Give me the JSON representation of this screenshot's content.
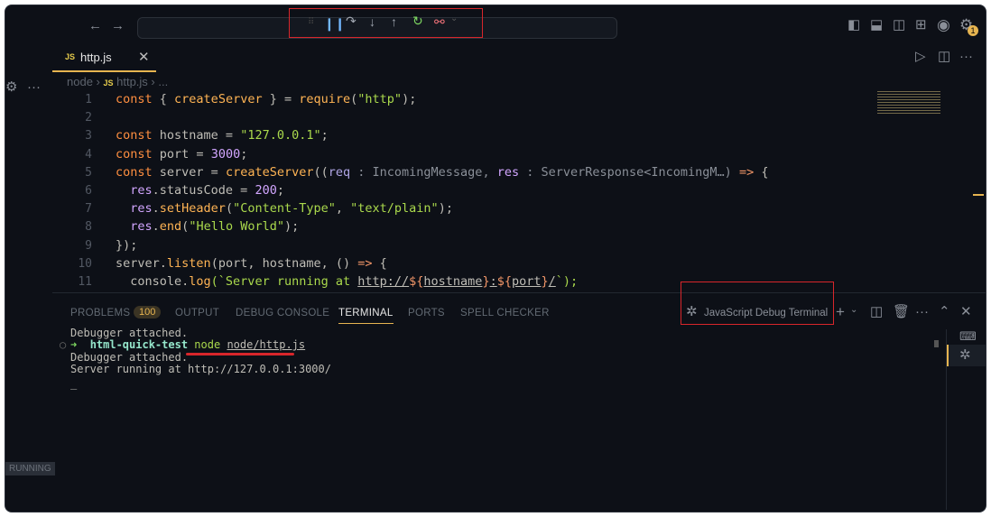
{
  "titlebar": {
    "nav_back": "←",
    "nav_forward": "→"
  },
  "debug_toolbar": {
    "items": [
      "drag-handle",
      "pause",
      "step-over",
      "step-into",
      "step-out",
      "restart",
      "disconnect"
    ]
  },
  "editor": {
    "tab_label": "http.js",
    "tab_icon": "JS",
    "breadcrumb": [
      "node",
      "http.js",
      "..."
    ],
    "lines": [
      [
        [
          "const ",
          "keyword"
        ],
        [
          "{ ",
          "plain"
        ],
        [
          "createServer",
          "fn"
        ],
        [
          " } = ",
          "plain"
        ],
        [
          "require",
          "fn"
        ],
        [
          "(",
          "plain"
        ],
        [
          "\"http\"",
          "str"
        ],
        [
          ");",
          "plain"
        ]
      ],
      [],
      [
        [
          "const ",
          "keyword"
        ],
        [
          "hostname = ",
          "plain"
        ],
        [
          "\"127.0.0.1\"",
          "str"
        ],
        [
          ";",
          "plain"
        ]
      ],
      [
        [
          "const ",
          "keyword"
        ],
        [
          "port = ",
          "plain"
        ],
        [
          "3000",
          "num"
        ],
        [
          ";",
          "plain"
        ]
      ],
      [
        [
          "const ",
          "keyword"
        ],
        [
          "server = ",
          "plain"
        ],
        [
          "createServer",
          "fn"
        ],
        [
          "((",
          "plain"
        ],
        [
          "req",
          "param"
        ],
        [
          " : IncomingMessage, ",
          "hint"
        ],
        [
          "res",
          "prop"
        ],
        [
          " : ServerResponse<IncomingM…) ",
          "hint"
        ],
        [
          "=>",
          "op"
        ],
        [
          " {",
          "plain"
        ]
      ],
      [
        [
          "  res",
          "prop"
        ],
        [
          ".statusCode = ",
          "plain"
        ],
        [
          "200",
          "num"
        ],
        [
          ";",
          "plain"
        ]
      ],
      [
        [
          "  res",
          "prop"
        ],
        [
          ".",
          "plain"
        ],
        [
          "setHeader",
          "fn"
        ],
        [
          "(",
          "plain"
        ],
        [
          "\"Content-Type\"",
          "str"
        ],
        [
          ", ",
          "plain"
        ],
        [
          "\"text/plain\"",
          "str"
        ],
        [
          ");",
          "plain"
        ]
      ],
      [
        [
          "  res",
          "prop"
        ],
        [
          ".",
          "plain"
        ],
        [
          "end",
          "fn"
        ],
        [
          "(",
          "plain"
        ],
        [
          "\"Hello World\"",
          "str"
        ],
        [
          ");",
          "plain"
        ]
      ],
      [
        [
          "});",
          "plain"
        ]
      ],
      [
        [
          "server.",
          "plain"
        ],
        [
          "listen",
          "fn"
        ],
        [
          "(port, hostname, () ",
          "plain"
        ],
        [
          "=>",
          "op"
        ],
        [
          " {",
          "plain"
        ]
      ],
      [
        [
          "  console.",
          "plain"
        ],
        [
          "log",
          "fn"
        ],
        [
          "(`Server running at ",
          "str"
        ],
        [
          "http://",
          "url"
        ],
        [
          "${",
          "op"
        ],
        [
          "hostname",
          "url"
        ],
        [
          "}",
          "op"
        ],
        [
          ":",
          "url"
        ],
        [
          "${",
          "op"
        ],
        [
          "port",
          "url"
        ],
        [
          "}",
          "op"
        ],
        [
          "/",
          "url"
        ],
        [
          "`);",
          "str"
        ]
      ]
    ]
  },
  "panel": {
    "tabs": [
      "PROBLEMS",
      "OUTPUT",
      "DEBUG CONSOLE",
      "TERMINAL",
      "PORTS",
      "SPELL CHECKER"
    ],
    "problems_count": "100",
    "terminal_name": "JavaScript Debug Terminal",
    "terminal_lines": {
      "l1": "Debugger attached.",
      "prompt_arrow": "➜",
      "dir": "html-quick-test",
      "cmd": "node",
      "arg": "node/http.js",
      "l3": "Debugger attached.",
      "l4": "Server running at http://127.0.0.1:3000/",
      "cursor": "_"
    }
  },
  "status": {
    "running": "RUNNING"
  },
  "settings_badge": "1",
  "colors": {
    "accent": "#e6b450",
    "highlight": "#d8262b"
  }
}
